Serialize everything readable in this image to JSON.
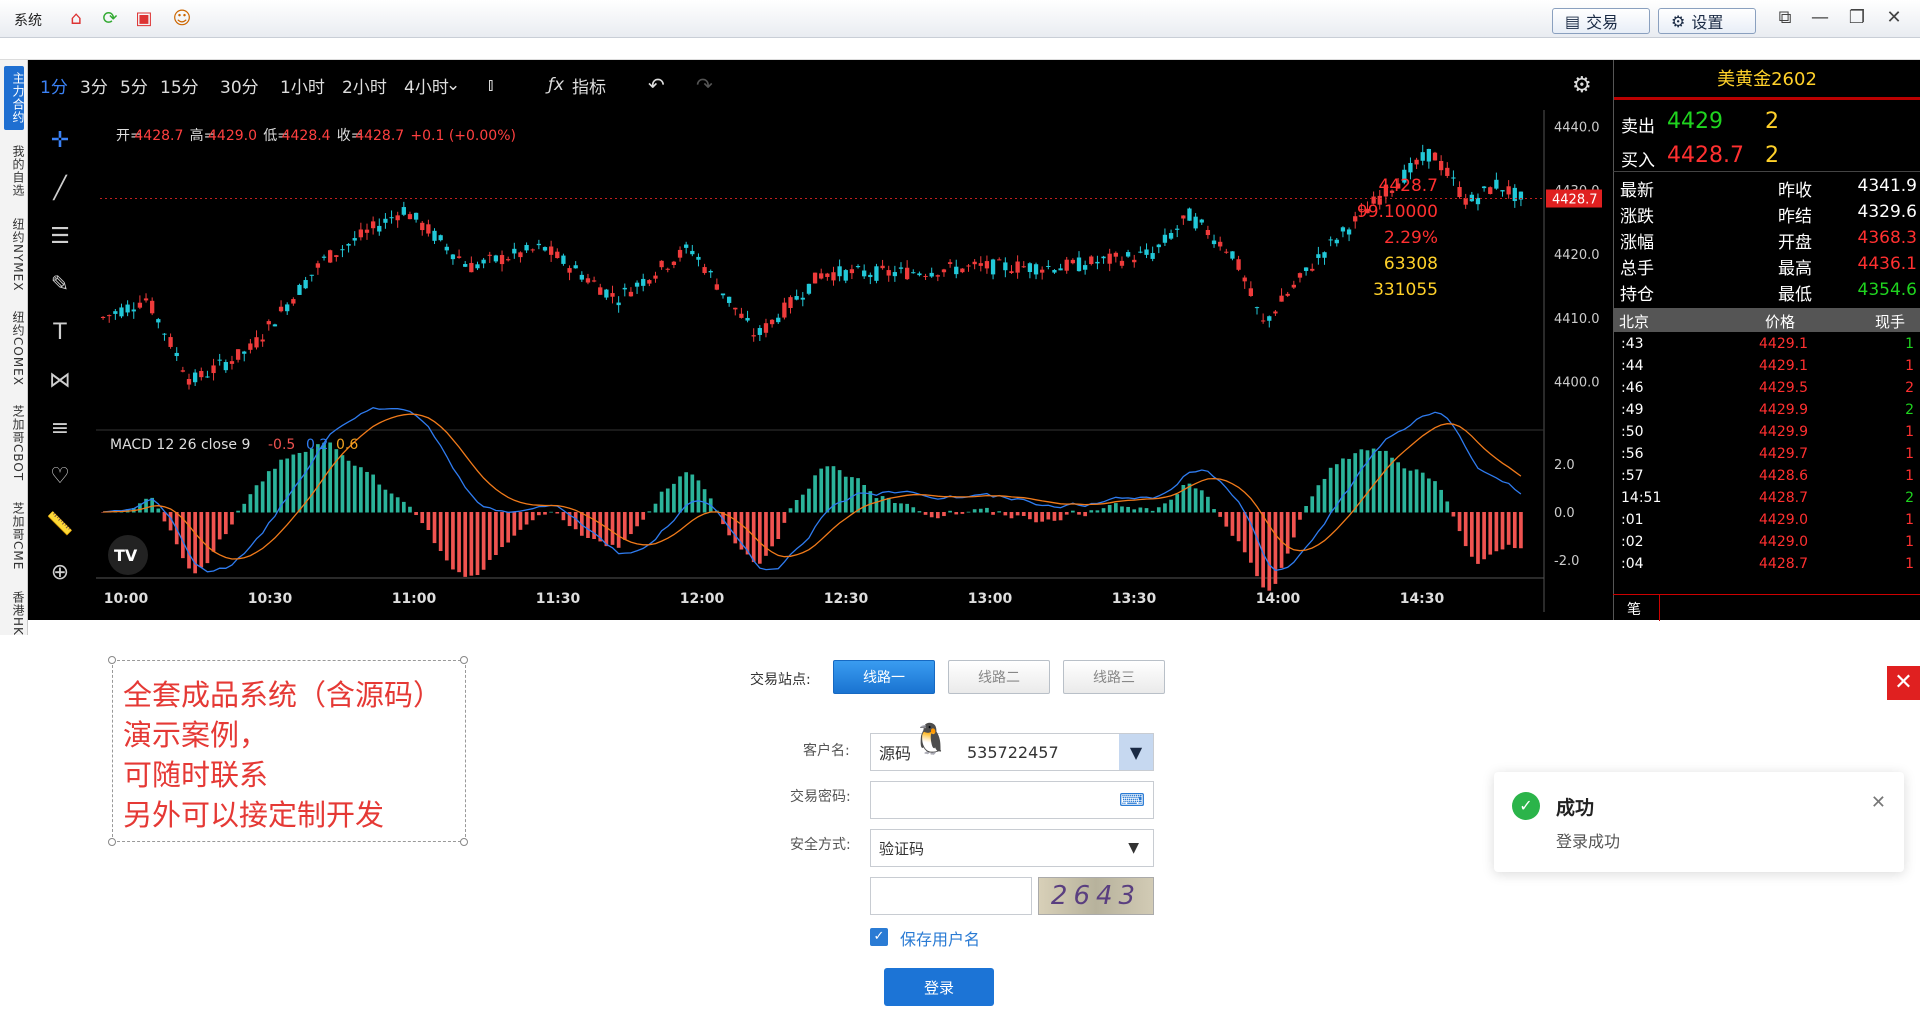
{
  "topbar": {
    "system": "系统",
    "trade_btn": "交易",
    "settings_btn": "设置"
  },
  "side_tabs": [
    "主力合约",
    "我的自选",
    "纽约NYMEX",
    "纽约COMEX",
    "芝加哥CBOT",
    "芝加哥CME",
    "香港HK"
  ],
  "timeframes": [
    "1分",
    "3分",
    "5分",
    "15分",
    "30分",
    "1小时",
    "2小时",
    "4小时"
  ],
  "active_timeframe": "1分",
  "indicator_label": "指标",
  "ohlc": {
    "open_label": "开=",
    "open": "4428.7",
    "high_label": "高=",
    "high": "4429.0",
    "low_label": "低=",
    "low": "4428.4",
    "close_label": "收=",
    "close": "4428.7",
    "change": "+0.1 (+0.00%)"
  },
  "price_axis": [
    "4440.0",
    "4430.0",
    "4420.0",
    "4410.0",
    "4400.0"
  ],
  "current_price_tag": "4428.7",
  "macd": {
    "label": "MACD 12 26 close 9",
    "v1": "-0.5",
    "v2": "0.2",
    "v3": "0.6",
    "axis": [
      "2.0",
      "0.0",
      "-2.0"
    ]
  },
  "time_axis": [
    "10:00",
    "10:30",
    "11:00",
    "11:30",
    "12:00",
    "12:30",
    "13:00",
    "13:30",
    "14:00",
    "14:30"
  ],
  "quote": {
    "title": "美黄金2602",
    "sell_label": "卖出",
    "sell_price": "4429",
    "sell_vol": "2",
    "buy_label": "买入",
    "buy_price": "4428.7",
    "buy_vol": "2",
    "rows": [
      {
        "l1": "最新",
        "v1": "4428.7",
        "l2": "昨收",
        "v2": "4341.9"
      },
      {
        "l1": "涨跌",
        "v1": "99.10000",
        "l2": "昨结",
        "v2": "4329.6"
      },
      {
        "l1": "涨幅",
        "v1": "2.29%",
        "l2": "开盘",
        "v2": "4368.3"
      },
      {
        "l1": "总手",
        "v1": "63308",
        "l2": "最高",
        "v2": "4436.1"
      },
      {
        "l1": "持仓",
        "v1": "331055",
        "l2": "最低",
        "v2": "4354.6"
      }
    ],
    "tick_headers": [
      "北京",
      "价格",
      "现手"
    ],
    "ticks": [
      {
        "t": ":43",
        "p": "4429.1",
        "v": "1",
        "c": "#1fd41f"
      },
      {
        "t": ":44",
        "p": "4429.1",
        "v": "1",
        "c": "#ff3030"
      },
      {
        "t": ":46",
        "p": "4429.5",
        "v": "2",
        "c": "#ff3030"
      },
      {
        "t": ":49",
        "p": "4429.9",
        "v": "2",
        "c": "#1fd41f"
      },
      {
        "t": ":50",
        "p": "4429.9",
        "v": "1",
        "c": "#ff3030"
      },
      {
        "t": ":56",
        "p": "4429.7",
        "v": "1",
        "c": "#ff3030"
      },
      {
        "t": ":57",
        "p": "4428.6",
        "v": "1",
        "c": "#ff3030"
      },
      {
        "t": "14:51",
        "p": "4428.7",
        "v": "2",
        "c": "#1fd41f"
      },
      {
        "t": ":01",
        "p": "4429.0",
        "v": "1",
        "c": "#ff3030"
      },
      {
        "t": ":02",
        "p": "4429.0",
        "v": "1",
        "c": "#ff3030"
      },
      {
        "t": ":04",
        "p": "4428.7",
        "v": "1",
        "c": "#ff3030"
      }
    ],
    "bottom_label": "笔"
  },
  "note": {
    "line1": "全套成品系统（含源码）",
    "line2": "演示案例，",
    "line3": "可随时联系",
    "line4": "另外可以接定制开发"
  },
  "login": {
    "site_label": "交易站点:",
    "routes": [
      "线路一",
      "线路二",
      "线路三"
    ],
    "user_label": "客户名:",
    "user_value": "源码",
    "qq": "535722457",
    "pwd_label": "交易密码:",
    "security_label": "安全方式:",
    "security_value": "验证码",
    "captcha": "2643",
    "remember": "保存用户名",
    "submit": "登录"
  },
  "toast": {
    "title": "成功",
    "message": "登录成功"
  },
  "colors": {
    "up": "#ef3b3b",
    "down": "#22c8d8",
    "bg": "#000000",
    "accent": "#1c74d6"
  }
}
